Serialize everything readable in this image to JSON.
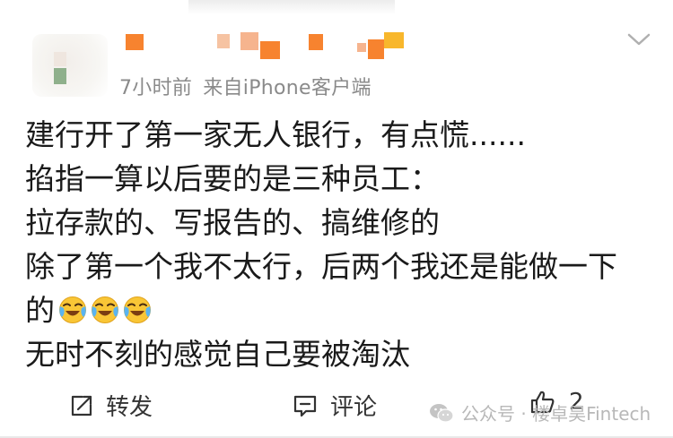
{
  "post": {
    "meta": {
      "time": "7小时前",
      "source": "来自iPhone客户端"
    },
    "lines": [
      "建行开了第一家无人银行，有点慌......",
      "掐指一算以后要的是三种员工：",
      "拉存款的、写报告的、搞维修的",
      "除了第一个我不太行，后两个我还是能做一下",
      "的",
      "无时不刻的感觉自己要被淘汰"
    ],
    "emoji_count": 3,
    "emoji_name": "crying-laughing-emoji"
  },
  "actions": {
    "repost_label": "转发",
    "comment_label": "评论",
    "like_count": "2"
  },
  "watermark": {
    "text": "公众号 · 楼卓昊Fintech"
  },
  "colors": {
    "mosaic_orange": "#f7832f",
    "mosaic_peach": "#f6b48e",
    "mosaic_yellow": "#f8b72c",
    "avatar_green": "#8fb08c",
    "meta_gray": "#8a8a8a",
    "text": "#1a1a1a"
  }
}
